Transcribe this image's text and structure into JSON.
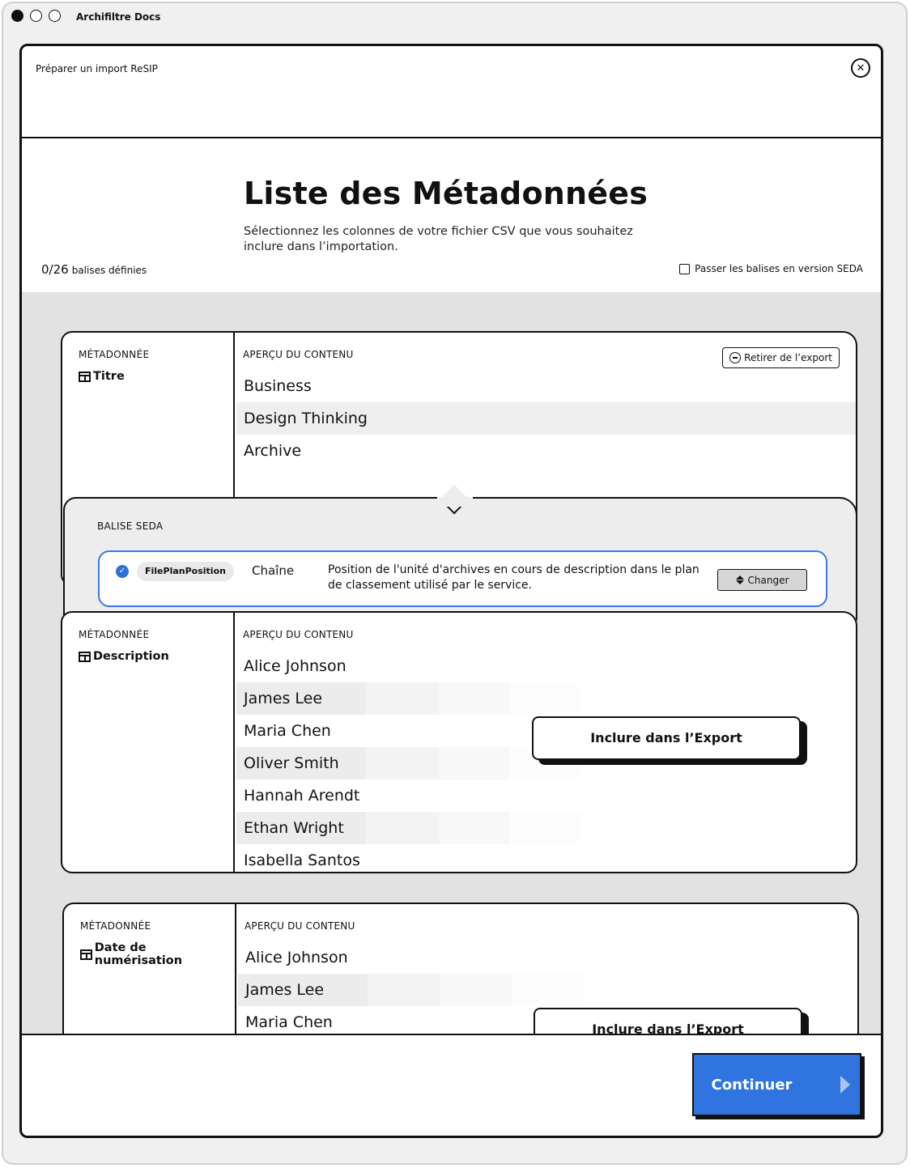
{
  "window": {
    "app_title": "Archifiltre Docs"
  },
  "modal": {
    "header_title": "Préparer un import ReSIP",
    "close_icon": "close-icon"
  },
  "intro": {
    "title": "Liste des Métadonnées",
    "subtitle": "Sélectionnez les colonnes de votre fichier CSV que vous souhaitez inclure dans l’importation.",
    "counter_value": "0/26",
    "counter_label": "balises définies",
    "seda_toggle_label": "Passer les balises en version SEDA",
    "seda_toggle_checked": false
  },
  "cards": [
    {
      "meta_label": "MÉTADONNÉE",
      "meta_name": "Titre",
      "preview_label": "APERÇU DU CONTENU",
      "remove_label": "Retirer de l’export",
      "rows": [
        "Business",
        "Design Thinking",
        "Archive"
      ]
    },
    {
      "meta_label": "MÉTADONNÉE",
      "meta_name": "Description",
      "preview_label": "APERÇU DU CONTENU",
      "include_label": "Inclure dans l’Export",
      "rows": [
        "Alice Johnson",
        "James Lee",
        "Maria Chen",
        "Oliver Smith",
        "Hannah Arendt",
        "Ethan Wright",
        "Isabella Santos"
      ]
    },
    {
      "meta_label": "MÉTADONNÉE",
      "meta_name": "Date de numérisation",
      "preview_label": "APERÇU DU CONTENU",
      "include_label": "Inclure dans l’Export",
      "rows": [
        "Alice Johnson",
        "James Lee",
        "Maria Chen"
      ]
    }
  ],
  "seda": {
    "label": "BALISE SEDA",
    "tag": "FilePlanPosition",
    "type": "Chaîne",
    "description": "Position de l'unité d'archives en cours de description dans le plan de classement utilisé par le service.",
    "change_label": "Changer",
    "accent": "#3c78e6"
  },
  "footer": {
    "continue_label": "Continuer",
    "accent": "#2f74df"
  }
}
